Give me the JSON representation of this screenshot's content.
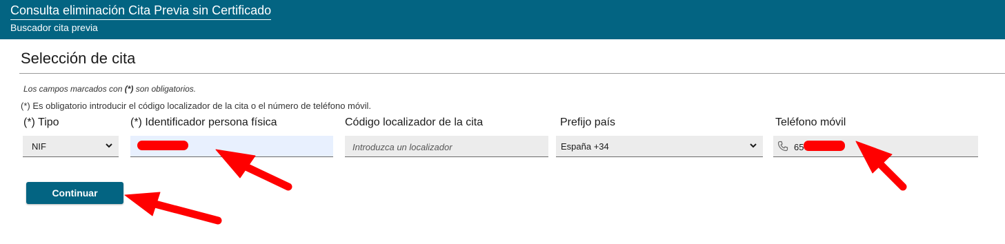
{
  "header": {
    "title": "Consulta eliminación Cita Previa sin Certificado",
    "subtitle": "Buscador cita previa",
    "background": "#036482"
  },
  "page": {
    "title": "Selección de cita",
    "note_prefix": "Los campos marcados con ",
    "note_mark": "(*)",
    "note_suffix": " son obligatorios.",
    "required_note": "(*) Es obligatorio introducir el código localizador de la cita o el número de teléfono móvil."
  },
  "form": {
    "tipo": {
      "label": "(*) Tipo",
      "value": "NIF"
    },
    "identificador": {
      "label": "(*) Identificador persona física",
      "value_redacted": true
    },
    "localizador": {
      "label": "Código localizador de la cita",
      "placeholder": "Introduzca un localizador"
    },
    "prefijo": {
      "label": "Prefijo país",
      "value": "España +34"
    },
    "telefono": {
      "label": "Teléfono móvil",
      "value_visible": "65",
      "value_redacted": true,
      "icon": "phone-icon"
    }
  },
  "actions": {
    "continue_label": "Continuar"
  },
  "annotations": {
    "arrow_color": "#ff0000",
    "arrow_count": 3,
    "redaction_color": "#ff0000"
  }
}
